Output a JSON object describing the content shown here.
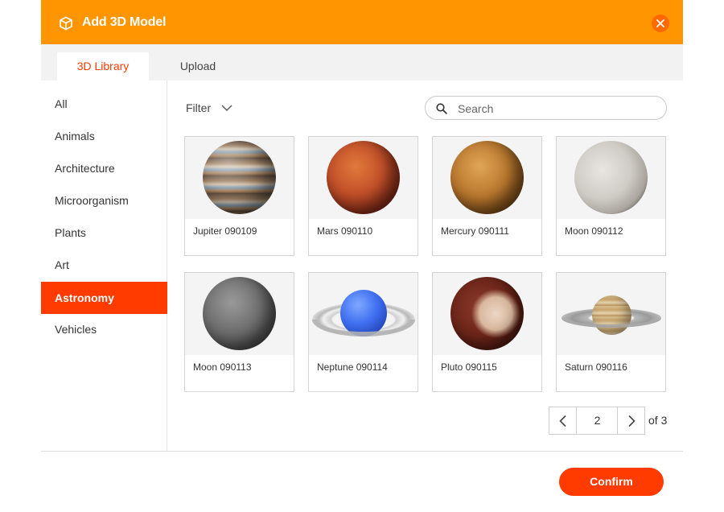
{
  "header": {
    "title": "Add 3D Model",
    "title_icon": "cube-icon",
    "close_icon": "close-icon",
    "color": "#ff9500"
  },
  "tabs": [
    {
      "label": "3D Library",
      "active": true
    },
    {
      "label": "Upload",
      "active": false
    }
  ],
  "sidebar": {
    "items": [
      {
        "label": "All",
        "active": false
      },
      {
        "label": "Animals",
        "active": false
      },
      {
        "label": "Architecture",
        "active": false
      },
      {
        "label": "Microorganism",
        "active": false
      },
      {
        "label": "Plants",
        "active": false
      },
      {
        "label": "Art",
        "active": false
      },
      {
        "label": "Astronomy",
        "active": true
      },
      {
        "label": "Vehicles",
        "active": false
      }
    ]
  },
  "toolbar": {
    "filter_label": "Filter",
    "search_placeholder": "Search",
    "search_value": ""
  },
  "models": [
    {
      "name": "Jupiter 090109"
    },
    {
      "name": "Mars 090110"
    },
    {
      "name": "Mercury 090111"
    },
    {
      "name": "Moon 090112"
    },
    {
      "name": "Moon 090113"
    },
    {
      "name": "Neptune 090114"
    },
    {
      "name": "Pluto 090115"
    },
    {
      "name": "Saturn 090116"
    }
  ],
  "pagination": {
    "current_page": "2",
    "total_label": "of 3"
  },
  "footer": {
    "confirm_label": "Confirm"
  },
  "colors": {
    "accent": "#ff3b00",
    "header": "#ff9500"
  }
}
